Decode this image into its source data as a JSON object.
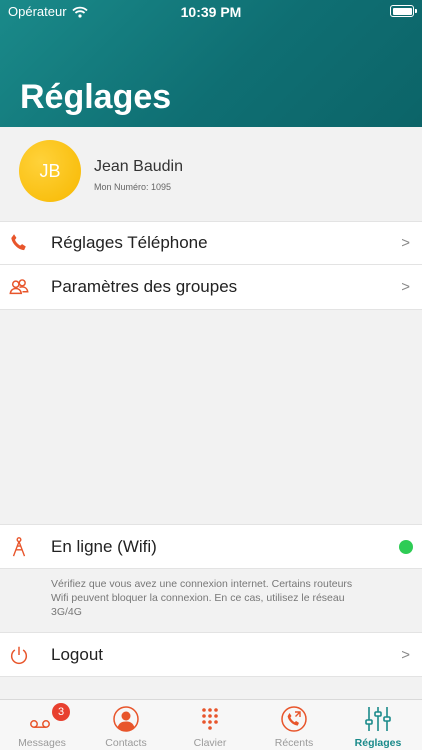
{
  "status_bar": {
    "carrier": "Opérateur",
    "time": "10:39 PM"
  },
  "header": {
    "title": "Réglages"
  },
  "profile": {
    "initials": "JB",
    "name": "Jean Baudin",
    "number": "Mon Numéro: 1095"
  },
  "menu": [
    {
      "label": "Réglages Téléphone",
      "icon": "phone-icon"
    },
    {
      "label": "Paramètres des groupes",
      "icon": "group-icon"
    }
  ],
  "connection": {
    "label": "En ligne (Wifi)",
    "status_color": "#2ecc55",
    "note": "Vérifiez que vous avez une connexion internet. Certains routeurs Wifi peuvent bloquer la connexion. En ce cas, utilisez le réseau 3G/4G"
  },
  "logout": {
    "label": "Logout"
  },
  "chevron": ">",
  "tabs": [
    {
      "label": "Messages",
      "icon": "messages-icon",
      "badge": "3"
    },
    {
      "label": "Contacts",
      "icon": "contact-icon"
    },
    {
      "label": "Clavier",
      "icon": "keypad-icon"
    },
    {
      "label": "Récents",
      "icon": "recent-calls-icon"
    },
    {
      "label": "Réglages",
      "icon": "sliders-icon",
      "active": true
    }
  ],
  "colors": {
    "accent": "#1a8a8a",
    "icon": "#e8552b",
    "avatar": "#f7b800"
  }
}
